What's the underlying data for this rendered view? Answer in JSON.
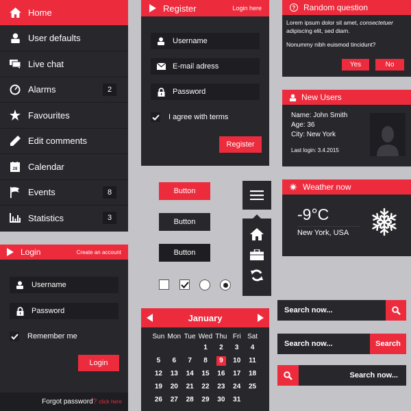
{
  "colors": {
    "accent": "#ec2b3d",
    "panel": "#28272c",
    "background": "#c3c3c8"
  },
  "sidebar": {
    "items": [
      {
        "label": "Home",
        "icon": "home-icon",
        "active": true,
        "badge": null
      },
      {
        "label": "User defaults",
        "icon": "user-icon",
        "active": false,
        "badge": null
      },
      {
        "label": "Live chat",
        "icon": "chat-icon",
        "active": false,
        "badge": null
      },
      {
        "label": "Alarms",
        "icon": "clock-icon",
        "active": false,
        "badge": "2"
      },
      {
        "label": "Favourites",
        "icon": "star-icon",
        "active": false,
        "badge": null
      },
      {
        "label": "Edit comments",
        "icon": "pencil-icon",
        "active": false,
        "badge": null
      },
      {
        "label": "Calendar",
        "icon": "calendar-icon",
        "active": false,
        "badge": null
      },
      {
        "label": "Events",
        "icon": "flag-icon",
        "active": false,
        "badge": "8"
      },
      {
        "label": "Statistics",
        "icon": "chart-icon",
        "active": false,
        "badge": "3"
      }
    ],
    "calendar_icon_text": "28"
  },
  "register": {
    "title": "Register",
    "login_link": "Login here",
    "username_placeholder": "Username",
    "email_placeholder": "E-mail adress",
    "password_placeholder": "Password",
    "agree_label": "I agree with terms",
    "agree_checked": true,
    "submit_label": "Register"
  },
  "question": {
    "title": "Random question",
    "text_plain": "Lorem ipsum dolor sit amet, ",
    "text_italic": "consectetuer",
    "text_rest": "adipiscing elit, sed diam.",
    "question": "Nonummy nibh euismod tincidunt?",
    "yes_label": "Yes",
    "no_label": "No"
  },
  "new_users": {
    "title": "New Users",
    "name": "Name: John Smith",
    "age": "Age: 36",
    "city": "City: New York",
    "last_login": "Last login: 3.4.2015"
  },
  "weather": {
    "title": "Weather now",
    "temperature": "-9°C",
    "location": "New York, USA",
    "icon": "snowflake-icon"
  },
  "login": {
    "title": "Login",
    "create_link": "Create an account",
    "username_placeholder": "Username",
    "password_placeholder": "Password",
    "remember_label": "Remember me",
    "remember_checked": true,
    "submit_label": "Login",
    "forgot_text": "Forgot password",
    "forgot_q": "?",
    "click_here": "click here"
  },
  "buttons": {
    "red_label": "Button",
    "dark_label": "Button",
    "darker_label": "Button"
  },
  "toggles": {
    "checkbox_unchecked": false,
    "checkbox_checked": true,
    "radio_unselected": false,
    "radio_selected": true
  },
  "calendar": {
    "month": "January",
    "weekdays": [
      "Sun",
      "Mon",
      "Tue",
      "Wed",
      "Thu",
      "Fri",
      "Sat"
    ],
    "days": [
      "",
      "",
      "",
      "1",
      "2",
      "3",
      "4",
      "5",
      "6",
      "7",
      "8",
      "9",
      "10",
      "11",
      "12",
      "13",
      "14",
      "15",
      "16",
      "17",
      "18",
      "19",
      "20",
      "21",
      "22",
      "23",
      "24",
      "25",
      "26",
      "27",
      "28",
      "29",
      "30",
      "31",
      ""
    ],
    "selected_day": "9"
  },
  "search": {
    "bar1_placeholder": "Search now...",
    "bar2_placeholder": "Search now...",
    "bar2_button": "Search",
    "bar3_placeholder": "Search now..."
  }
}
